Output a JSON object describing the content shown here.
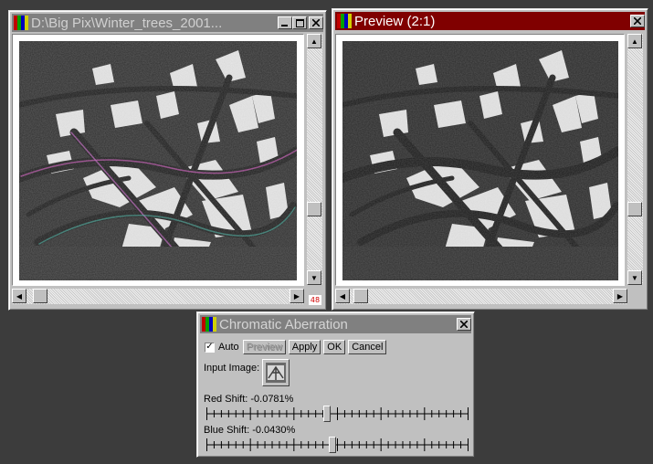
{
  "source_window": {
    "title": "D:\\Big Pix\\Winter_trees_2001...",
    "zoom_badge": "48",
    "vscroll_position": 0.76,
    "hscroll_position": 0.0
  },
  "preview_window": {
    "title": "Preview (2:1)",
    "vscroll_position": 0.76,
    "hscroll_position": 0.0
  },
  "dialog": {
    "title": "Chromatic Aberration",
    "auto_label": "Auto",
    "auto_checked": true,
    "buttons": {
      "preview": "Preview",
      "apply": "Apply",
      "ok": "OK",
      "cancel": "Cancel"
    },
    "input_image_label": "Input Image:",
    "red_shift_label": "Red Shift: -0.0781%",
    "red_shift_position": 0.46,
    "blue_shift_label": "Blue Shift: -0.0430%",
    "blue_shift_position": 0.48
  },
  "colors": {
    "desktop": "#3c3c3c",
    "inactive_title": "#808080",
    "active_title": "#800000",
    "face": "#c0c0c0"
  },
  "icons": {
    "app": "palette-app-icon",
    "minimize": "minimize-icon",
    "maximize": "maximize-icon",
    "close": "close-icon"
  }
}
